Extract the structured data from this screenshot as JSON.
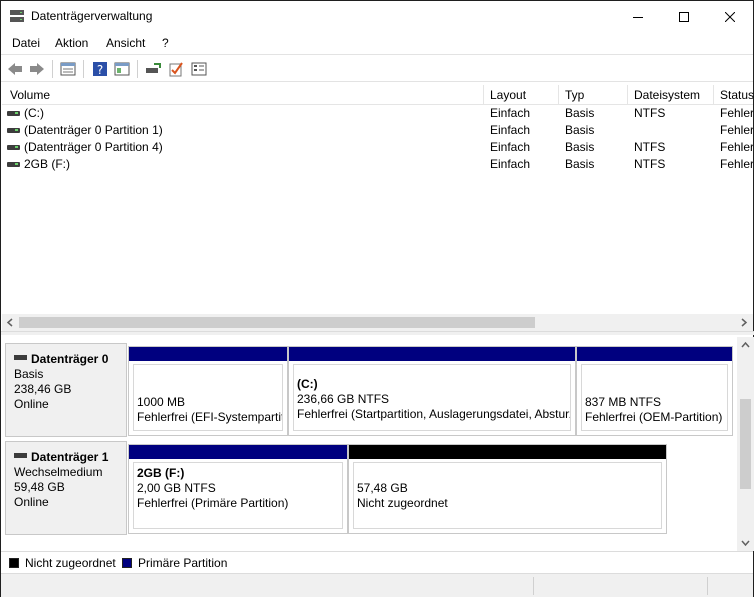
{
  "window": {
    "title": "Datenträgerverwaltung"
  },
  "menu": {
    "items": [
      {
        "label": "Datei"
      },
      {
        "label": "Aktion"
      },
      {
        "label": "Ansicht"
      },
      {
        "label": "?"
      }
    ]
  },
  "toolbar": {
    "icons": [
      "back-icon",
      "forward-icon",
      "show-list-icon",
      "help-icon",
      "console-icon",
      "rescan-disk-icon",
      "check-icon",
      "properties-icon"
    ]
  },
  "volume_table": {
    "columns": [
      "Volume",
      "Layout",
      "Typ",
      "Dateisystem",
      "Status"
    ],
    "rows": [
      {
        "volume": " (C:)",
        "layout": "Einfach",
        "typ": "Basis",
        "fs": "NTFS",
        "status": "Fehler"
      },
      {
        "volume": "(Datenträger 0 Partition 1)",
        "layout": "Einfach",
        "typ": "Basis",
        "fs": "",
        "status": "Fehler"
      },
      {
        "volume": "(Datenträger 0 Partition 4)",
        "layout": "Einfach",
        "typ": "Basis",
        "fs": "NTFS",
        "status": "Fehler"
      },
      {
        "volume": "2GB (F:)",
        "layout": "Einfach",
        "typ": "Basis",
        "fs": "NTFS",
        "status": "Fehler"
      }
    ]
  },
  "disks": [
    {
      "name": "Datenträger 0",
      "type": "Basis",
      "size": "238,46 GB",
      "state": "Online",
      "partitions": [
        {
          "title": "",
          "line1": "1000 MB",
          "line2": "Fehlerfrei (EFI-Systempartiti",
          "bar_color": "#00007f"
        },
        {
          "title": " (C:)",
          "line1": "236,66 GB NTFS",
          "line2": "Fehlerfrei (Startpartition, Auslagerungsdatei, Absturz",
          "bar_color": "#00007f"
        },
        {
          "title": "",
          "line1": "837 MB NTFS",
          "line2": "Fehlerfrei (OEM-Partition)",
          "bar_color": "#00007f"
        }
      ]
    },
    {
      "name": "Datenträger 1",
      "type": "Wechselmedium",
      "size": "59,48 GB",
      "state": "Online",
      "partitions": [
        {
          "title": "2GB  (F:)",
          "line1": "2,00 GB NTFS",
          "line2": "Fehlerfrei (Primäre Partition)",
          "bar_color": "#00007f"
        },
        {
          "title": "",
          "line1": "57,48 GB",
          "line2": "Nicht zugeordnet",
          "bar_color": "#000000"
        }
      ]
    }
  ],
  "legend": [
    {
      "label": "Nicht zugeordnet",
      "color": "#000000"
    },
    {
      "label": "Primäre Partition",
      "color": "#00007f"
    }
  ]
}
